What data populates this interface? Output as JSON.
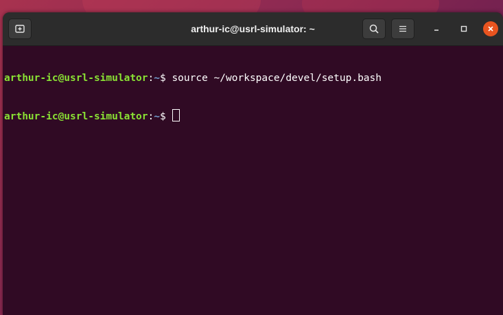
{
  "window": {
    "title": "arthur-ic@usrl-simulator: ~"
  },
  "titlebar": {
    "new_tab_icon": "new-tab-icon",
    "search_icon": "search-icon",
    "menu_icon": "hamburger-menu-icon",
    "minimize_icon": "minimize-icon",
    "maximize_icon": "maximize-icon",
    "close_icon": "close-icon",
    "close_color": "#e9541f"
  },
  "terminal": {
    "background": "#300a24",
    "lines": [
      {
        "user_host": "arthur-ic@usrl-simulator",
        "colon": ":",
        "path": "~",
        "prompt": "$ ",
        "command": "source ~/workspace/devel/setup.bash"
      },
      {
        "user_host": "arthur-ic@usrl-simulator",
        "colon": ":",
        "path": "~",
        "prompt": "$ ",
        "command": ""
      }
    ]
  }
}
